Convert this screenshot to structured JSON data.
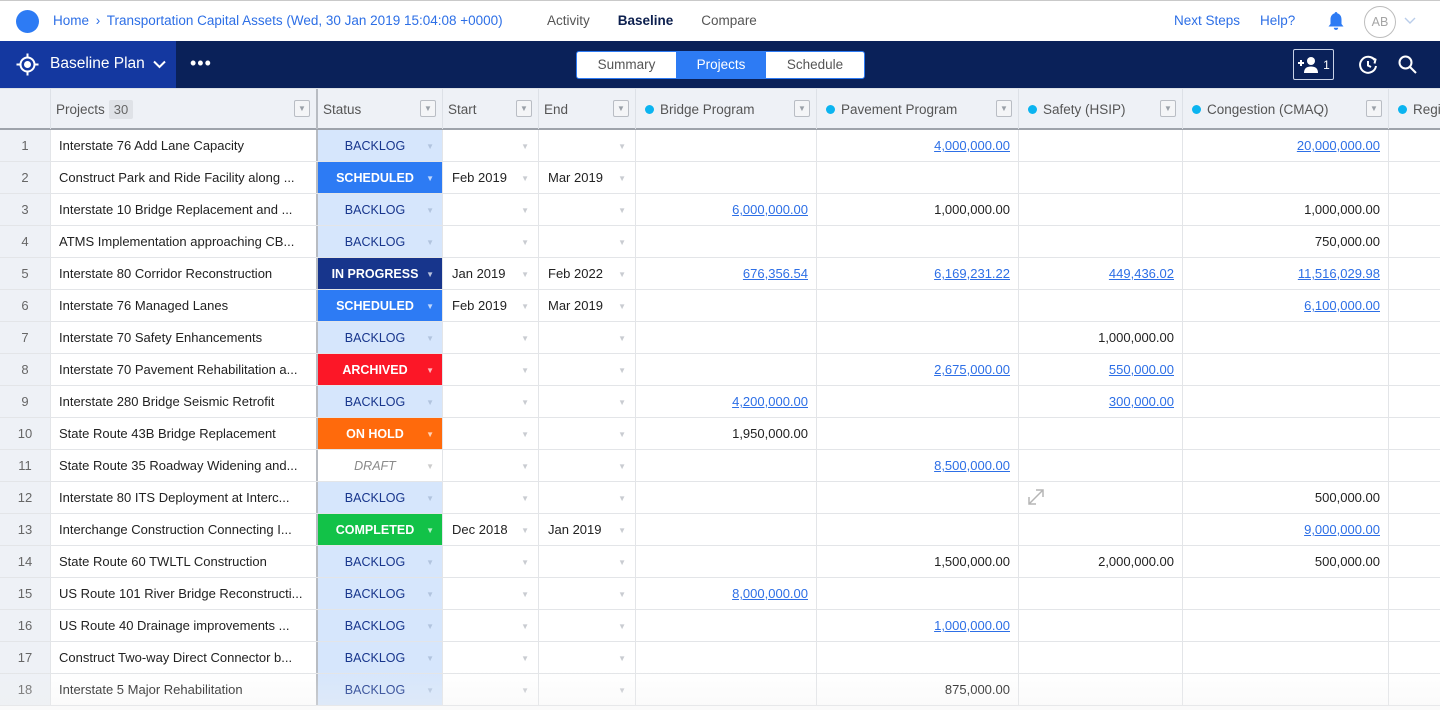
{
  "topbar": {
    "breadcrumb_home": "Home",
    "breadcrumb_separator": "›",
    "breadcrumb_current": "Transportation Capital Assets (Wed, 30 Jan 2019 15:04:08 +0000)",
    "nav": [
      {
        "label": "Activity",
        "active": false
      },
      {
        "label": "Baseline",
        "active": true
      },
      {
        "label": "Compare",
        "active": false
      }
    ],
    "next_steps": "Next Steps",
    "help": "Help?",
    "avatar_initials": "AB"
  },
  "toolbar": {
    "plan_label": "Baseline Plan",
    "more_label": "•••",
    "views": [
      {
        "label": "Summary",
        "active": false
      },
      {
        "label": "Projects",
        "active": true
      },
      {
        "label": "Schedule",
        "active": false
      }
    ],
    "add_user_count": "1"
  },
  "colors": {
    "accent": "#2d7bf4",
    "navy": "#0a2159",
    "plan_select": "#1438a0",
    "link": "#2d6fe6",
    "column_dot": "#0bb4f0"
  },
  "grid": {
    "columns": {
      "projects": "Projects",
      "projects_count": "30",
      "status": "Status",
      "start": "Start",
      "end": "End",
      "bridge": "Bridge Program",
      "pavement": "Pavement Program",
      "safety": "Safety (HSIP)",
      "congestion": "Congestion (CMAQ)",
      "regional": "Regi"
    },
    "rows": [
      {
        "num": "1",
        "name": "Interstate 76 Add Lane Capacity",
        "status": "BACKLOG",
        "start": "",
        "end": "",
        "bridge": "",
        "pavement": "4,000,000.00",
        "pavement_link": true,
        "safety": "",
        "congestion": "20,000,000.00",
        "congestion_link": true
      },
      {
        "num": "2",
        "name": "Construct Park and Ride Facility along ...",
        "status": "SCHEDULED",
        "start": "Feb 2019",
        "end": "Mar 2019",
        "bridge": "",
        "pavement": "",
        "safety": "",
        "congestion": ""
      },
      {
        "num": "3",
        "name": "Interstate 10 Bridge Replacement and ...",
        "status": "BACKLOG",
        "start": "",
        "end": "",
        "bridge": "6,000,000.00",
        "bridge_link": true,
        "pavement": "1,000,000.00",
        "safety": "",
        "congestion": "1,000,000.00"
      },
      {
        "num": "4",
        "name": "ATMS Implementation approaching CB...",
        "status": "BACKLOG",
        "start": "",
        "end": "",
        "bridge": "",
        "pavement": "",
        "safety": "",
        "congestion": "750,000.00"
      },
      {
        "num": "5",
        "name": "Interstate 80 Corridor Reconstruction",
        "status": "IN PROGRESS",
        "start": "Jan 2019",
        "end": "Feb 2022",
        "bridge": "676,356.54",
        "bridge_link": true,
        "pavement": "6,169,231.22",
        "pavement_link": true,
        "safety": "449,436.02",
        "safety_link": true,
        "congestion": "11,516,029.98",
        "congestion_link": true
      },
      {
        "num": "6",
        "name": "Interstate 76 Managed Lanes",
        "status": "SCHEDULED",
        "start": "Feb 2019",
        "end": "Mar 2019",
        "bridge": "",
        "pavement": "",
        "safety": "",
        "congestion": "6,100,000.00",
        "congestion_link": true
      },
      {
        "num": "7",
        "name": "Interstate 70 Safety Enhancements",
        "status": "BACKLOG",
        "start": "",
        "end": "",
        "bridge": "",
        "pavement": "",
        "safety": "1,000,000.00",
        "congestion": ""
      },
      {
        "num": "8",
        "name": "Interstate 70 Pavement Rehabilitation a...",
        "status": "ARCHIVED",
        "start": "",
        "end": "",
        "bridge": "",
        "pavement": "2,675,000.00",
        "pavement_link": true,
        "safety": "550,000.00",
        "safety_link": true,
        "congestion": ""
      },
      {
        "num": "9",
        "name": "Interstate 280 Bridge Seismic Retrofit",
        "status": "BACKLOG",
        "start": "",
        "end": "",
        "bridge": "4,200,000.00",
        "bridge_link": true,
        "pavement": "",
        "safety": "300,000.00",
        "safety_link": true,
        "congestion": ""
      },
      {
        "num": "10",
        "name": "State Route 43B Bridge Replacement",
        "status": "ON HOLD",
        "start": "",
        "end": "",
        "bridge": "1,950,000.00",
        "pavement": "",
        "safety": "",
        "congestion": ""
      },
      {
        "num": "11",
        "name": "State Route 35 Roadway Widening and...",
        "status": "DRAFT",
        "start": "",
        "end": "",
        "bridge": "",
        "pavement": "8,500,000.00",
        "pavement_link": true,
        "safety": "",
        "congestion": ""
      },
      {
        "num": "12",
        "name": "Interstate 80 ITS Deployment at Interc...",
        "status": "BACKLOG",
        "start": "",
        "end": "",
        "bridge": "",
        "pavement": "",
        "safety": "",
        "congestion": "500,000.00"
      },
      {
        "num": "13",
        "name": "Interchange Construction Connecting I...",
        "status": "COMPLETED",
        "start": "Dec 2018",
        "end": "Jan 2019",
        "bridge": "",
        "pavement": "",
        "safety": "",
        "congestion": "9,000,000.00",
        "congestion_link": true
      },
      {
        "num": "14",
        "name": "State Route 60 TWLTL Construction",
        "status": "BACKLOG",
        "start": "",
        "end": "",
        "bridge": "",
        "pavement": "1,500,000.00",
        "safety": "2,000,000.00",
        "congestion": "500,000.00"
      },
      {
        "num": "15",
        "name": "US Route 101 River Bridge Reconstructi...",
        "status": "BACKLOG",
        "start": "",
        "end": "",
        "bridge": "8,000,000.00",
        "bridge_link": true,
        "pavement": "",
        "safety": "",
        "congestion": ""
      },
      {
        "num": "16",
        "name": "US Route 40 Drainage improvements ...",
        "status": "BACKLOG",
        "start": "",
        "end": "",
        "bridge": "",
        "pavement": "1,000,000.00",
        "pavement_link": true,
        "safety": "",
        "congestion": ""
      },
      {
        "num": "17",
        "name": "Construct Two-way Direct Connector b...",
        "status": "BACKLOG",
        "start": "",
        "end": "",
        "bridge": "",
        "pavement": "",
        "safety": "",
        "congestion": ""
      },
      {
        "num": "18",
        "name": "Interstate 5 Major Rehabilitation",
        "status": "BACKLOG",
        "start": "",
        "end": "",
        "bridge": "",
        "pavement": "875,000.00",
        "safety": "",
        "congestion": ""
      }
    ],
    "dropdown_arrow": "▼"
  }
}
